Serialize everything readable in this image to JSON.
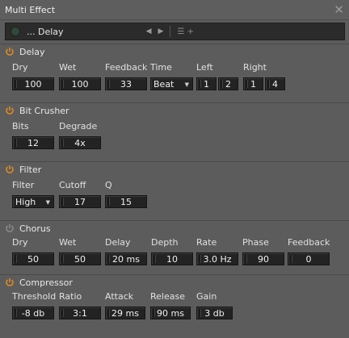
{
  "window": {
    "title": "Multi Effect"
  },
  "preset": {
    "name": "...  Delay"
  },
  "delay": {
    "title": "Delay",
    "labels": {
      "dry": "Dry",
      "wet": "Wet",
      "feedback": "Feedback",
      "time": "Time",
      "left": "Left",
      "right": "Right"
    },
    "values": {
      "dry": "100",
      "wet": "100",
      "feedback": "33",
      "time": "Beat",
      "left1": "1",
      "left2": "2",
      "right1": "1",
      "right2": "4"
    }
  },
  "bitcrusher": {
    "title": "Bit Crusher",
    "labels": {
      "bits": "Bits",
      "degrade": "Degrade"
    },
    "values": {
      "bits": "12",
      "degrade": "4x"
    }
  },
  "filter": {
    "title": "Filter",
    "labels": {
      "filter": "Filter",
      "cutoff": "Cutoff",
      "q": "Q"
    },
    "values": {
      "filter": "High",
      "cutoff": "17",
      "q": "15"
    }
  },
  "chorus": {
    "title": "Chorus",
    "labels": {
      "dry": "Dry",
      "wet": "Wet",
      "delay": "Delay",
      "depth": "Depth",
      "rate": "Rate",
      "phase": "Phase",
      "feedback": "Feedback"
    },
    "values": {
      "dry": "50",
      "wet": "50",
      "delay": "20 ms",
      "depth": "10",
      "rate": "3.0 Hz",
      "phase": "90",
      "feedback": "0"
    }
  },
  "compressor": {
    "title": "Compressor",
    "labels": {
      "threshold": "Threshold",
      "ratio": "Ratio",
      "attack": "Attack",
      "release": "Release",
      "gain": "Gain"
    },
    "values": {
      "threshold": "-8 db",
      "ratio": "3:1",
      "attack": "29 ms",
      "release": "90 ms",
      "gain": "3 db"
    }
  },
  "colors": {
    "power_on": "#e08a1e",
    "power_off": "#8a8a8a"
  }
}
